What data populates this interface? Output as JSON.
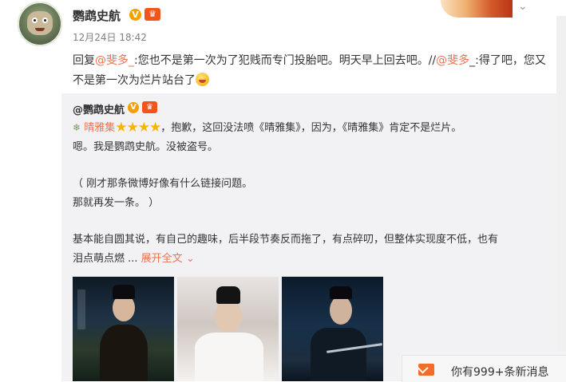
{
  "post": {
    "username": "鹦鹉史航",
    "verified_badge": "V",
    "crown_badge": "👑",
    "time": "12月24日 18:42",
    "text_prefix": "回复",
    "mention1": "@斐多_",
    "text_mid": ":您也不是第一次为了犯贱而专门投胎吧。明天早上回去吧。//",
    "mention2": "@斐多",
    "text_end": "_:得了吧，您又不是第一次为烂片站台了",
    "more_icon": "chevron-down-icon"
  },
  "repost": {
    "username": "@鹦鹉史航",
    "verified_badge": "V",
    "crown_badge": "👑",
    "poi_name": "晴雅集",
    "stars": "★★★★",
    "line1_rest": "，抱歉，这回没法喷《晴雅集》，因为，《晴雅集》肯定不是烂片。",
    "line2": "嗯。我是鹦鹉史航。没被盗号。",
    "line3": "（ 刚才那条微博好像有什么链接问题。",
    "line4": "那就再发一条。 ）",
    "line5": "基本能自圆其说，有自己的趣味，后半段节奏反而拖了，有点碎叨，但整体实现度不低，也有",
    "line6": "泪点萌点燃 ...",
    "expand": "展开全文"
  },
  "message": {
    "text": "你有999+条新消息"
  }
}
